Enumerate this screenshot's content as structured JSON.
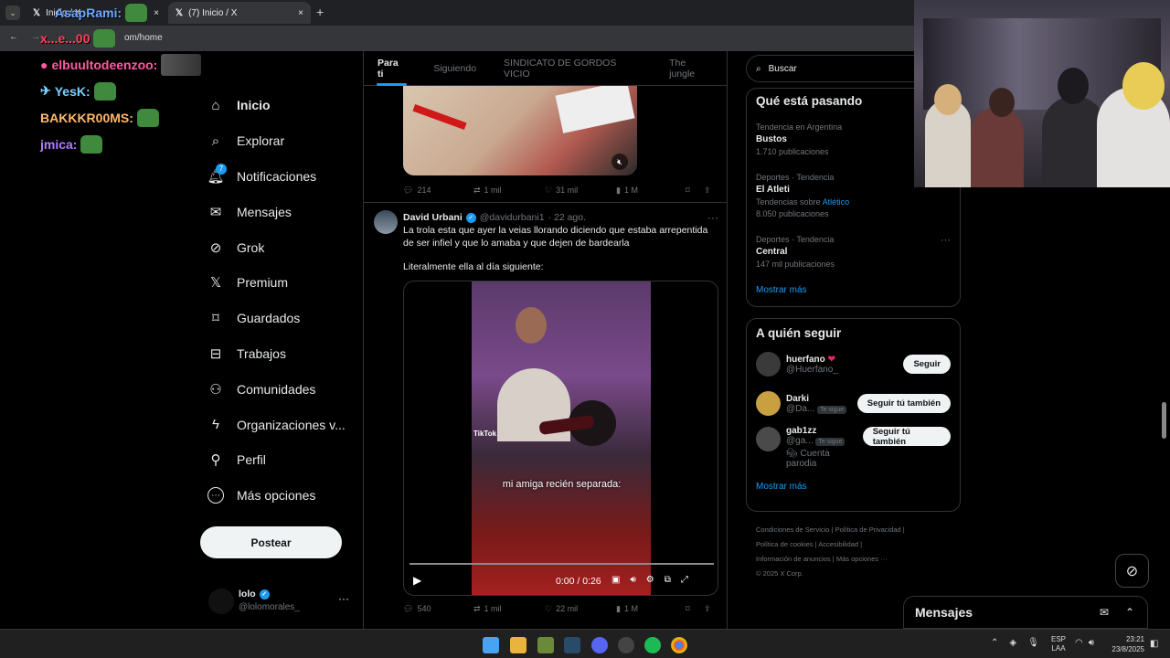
{
  "browser": {
    "tabs": [
      {
        "title": "Inicio / X"
      },
      {
        "title": "(7) Inicio / X"
      }
    ],
    "new_tab": "+",
    "close": "×",
    "url": "om/home"
  },
  "chat": {
    "lines": [
      {
        "user": "AsapRami:",
        "color": "#6ea8ff"
      },
      {
        "user": "x...e...00",
        "color": "#ff4060"
      },
      {
        "user": "elbuultodeenzoo:",
        "color": "#ff5aa0"
      },
      {
        "user": "YesK:",
        "color": "#7bd0ff"
      },
      {
        "user": "BAKKKR00MS:",
        "color": "#ffb86b"
      },
      {
        "user": "jmica:",
        "color": "#b07bff"
      }
    ]
  },
  "nav": {
    "items": [
      {
        "label": "Inicio",
        "icon": "home-icon",
        "glyph": "⌂"
      },
      {
        "label": "Explorar",
        "icon": "search-icon",
        "glyph": "⌕"
      },
      {
        "label": "Notificaciones",
        "icon": "bell-icon",
        "glyph": "♫",
        "badge": "7"
      },
      {
        "label": "Mensajes",
        "icon": "mail-icon",
        "glyph": "✉"
      },
      {
        "label": "Grok",
        "icon": "grok-icon",
        "glyph": "⊘"
      },
      {
        "label": "Premium",
        "icon": "x-logo-icon",
        "glyph": "𝕏"
      },
      {
        "label": "Guardados",
        "icon": "bookmark-icon",
        "glyph": "⌑"
      },
      {
        "label": "Trabajos",
        "icon": "briefcase-icon",
        "glyph": "⊟"
      },
      {
        "label": "Comunidades",
        "icon": "people-icon",
        "glyph": "⚇"
      },
      {
        "label": "Organizaciones v...",
        "icon": "lightning-icon",
        "glyph": "ϟ"
      },
      {
        "label": "Perfil",
        "icon": "person-icon",
        "glyph": "⚲"
      },
      {
        "label": "Más opciones",
        "icon": "more-circle-icon",
        "glyph": "⋯"
      }
    ],
    "post_button": "Postear"
  },
  "profile": {
    "name": "lolo",
    "handle": "@lolomorales_"
  },
  "feed": {
    "tabs": [
      "Para ti",
      "Siguiendo",
      "SINDICATO DE GORDOS VICIO",
      "The jungle"
    ],
    "first_post_actions": {
      "replies": "214",
      "reposts": "1 mil",
      "likes": "31 mil",
      "views": "1 M"
    },
    "post": {
      "name": "David Urbani",
      "handle": "@davidurbani1",
      "date": "· 22 ago.",
      "text1": "La trola esta que ayer la veias llorando diciendo que estaba arrepentida de ser infiel y que lo amaba y que dejen de bardearla",
      "text2": "Literalmente ella al día siguiente:",
      "video_caption": "mi amiga recién separada:",
      "video_time": "0:00 / 0:26",
      "tiktok": "TikTok",
      "actions": {
        "replies": "540",
        "reposts": "1 mil",
        "likes": "22 mil",
        "views": "1 M"
      }
    }
  },
  "right": {
    "search_placeholder": "Buscar",
    "trends_title": "Qué está pasando",
    "trends": [
      {
        "context": "Tendencia en Argentina",
        "name": "Bustos",
        "count": "1.710 publicaciones"
      },
      {
        "context": "Deportes · Tendencia",
        "name": "El Atleti",
        "extra_prefix": "Tendencias sobre",
        "extra_link": "Atlético",
        "count": "8.050 publicaciones"
      },
      {
        "context": "Deportes · Tendencia",
        "name": "Central",
        "count": "147 mil publicaciones"
      }
    ],
    "show_more": "Mostrar más",
    "follow_title": "A quién seguir",
    "follow": [
      {
        "name": "huerfano",
        "handle": "@Huerfano_",
        "button": "Seguir",
        "follows_you": ""
      },
      {
        "name": "Darki",
        "handle": "@Da...",
        "button": "Seguir tú también",
        "follows_you": "Te sigue"
      },
      {
        "name": "gab1zz",
        "handle": "@ga...",
        "button": "Seguir tú también",
        "follows_you": "Te sigue",
        "note": "Cuenta parodia"
      }
    ],
    "footer": [
      "Condiciones de Servicio",
      "Política de Privacidad",
      "Política de cookies",
      "Accesibilidad",
      "Información de anuncios",
      "Más opciones ···",
      "© 2025 X Corp."
    ]
  },
  "messages_bar": {
    "label": "Mensajes"
  },
  "taskbar": {
    "lang": "ESP",
    "lang2": "LAA",
    "time": "23:21",
    "date": "23/8/2025"
  }
}
